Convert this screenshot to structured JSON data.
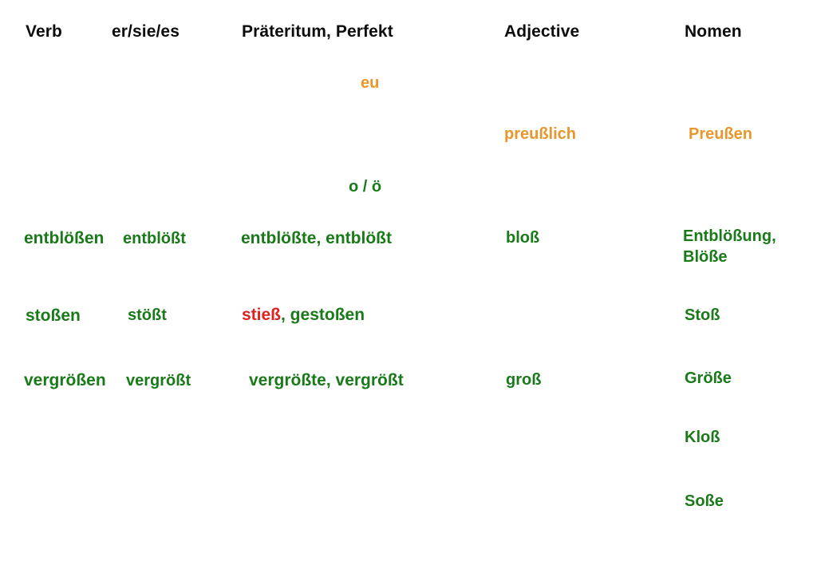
{
  "colors": {
    "header_text": "#0d0d0d",
    "green": "#1a7a1a",
    "orange": "#e8972d",
    "red": "#dd2222",
    "background": "#ffffff"
  },
  "headers": {
    "verb": "Verb",
    "person": "er/sie/es",
    "past": "Präteritum, Perfekt",
    "adjective": "Adjective",
    "noun": "Nomen"
  },
  "markers": {
    "eu": "eu",
    "o_oe": "o / ö"
  },
  "orange_row": {
    "adjective": "preußlich",
    "noun": "Preußen"
  },
  "rows": [
    {
      "verb": "entblößen",
      "person": "entblößt",
      "past": "entblößte, entblößt",
      "adjective": "bloß",
      "noun": "Entblößung, Blöße"
    },
    {
      "verb": "stoßen",
      "person": "stößt",
      "past_irregular": "stieß",
      "past_rest": ", gestoßen",
      "adjective": "",
      "noun": "Stoß"
    },
    {
      "verb": "vergrößen",
      "person": "vergrößt",
      "past": "vergrößte, vergrößt",
      "adjective": "groß",
      "noun": "Größe"
    }
  ],
  "extra_nouns": [
    {
      "noun": "Kloß"
    },
    {
      "noun": "Soße"
    }
  ]
}
